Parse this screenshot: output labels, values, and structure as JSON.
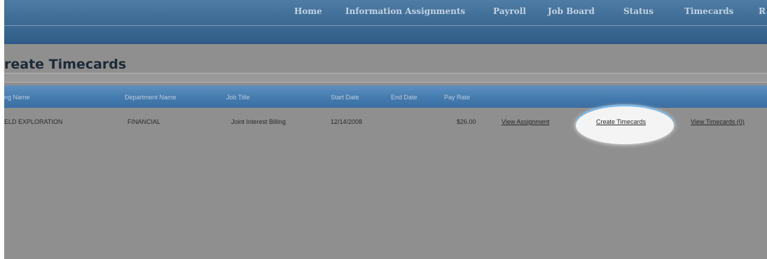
{
  "nav": {
    "items": [
      "Home",
      "Information Assignments",
      "Payroll",
      "Job Board",
      "Status",
      "Timecards",
      "R"
    ]
  },
  "page": {
    "title": "reate Timecards"
  },
  "table": {
    "headers": [
      "ng Name",
      "Department Name",
      "Job Title",
      "Start Date",
      "End Date",
      "Pay Rate"
    ],
    "row": {
      "company": "ELD EXPLORATION",
      "department": "FINANCIAL",
      "job_title": "Joint Interest Billing",
      "start_date": "12/14/2008",
      "end_date": "",
      "pay_rate": "$26.00",
      "view_assignment": "View Assignment",
      "create_timecards": "Create Timecards",
      "view_timecards": "View Timecards (0)"
    }
  },
  "colors": {
    "nav_bar": "#3b6890",
    "header_bar": "#4379ad",
    "background": "#8f8f8f",
    "highlight": "#f4f4f4",
    "highlight_glow": "#7fb6e0"
  }
}
